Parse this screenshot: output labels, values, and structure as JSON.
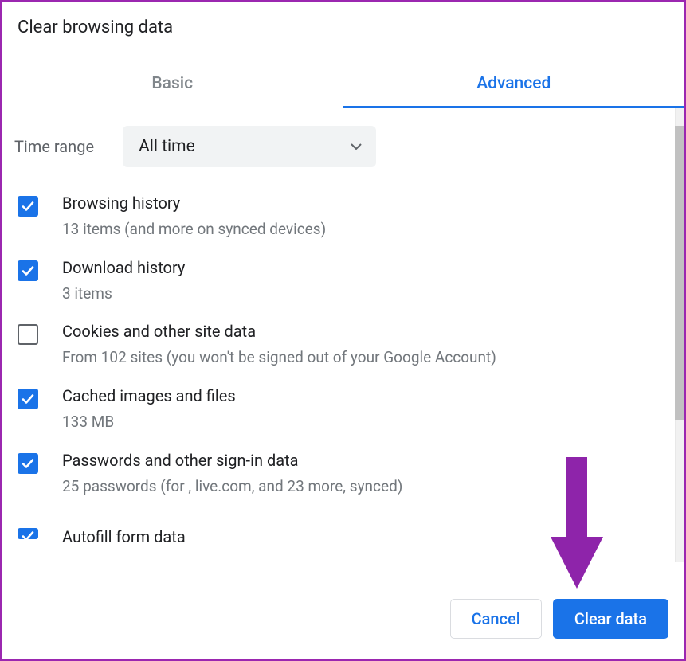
{
  "dialog": {
    "title": "Clear browsing data",
    "tabs": {
      "basic": "Basic",
      "advanced": "Advanced"
    },
    "time_range": {
      "label": "Time range",
      "value": "All time"
    },
    "items": [
      {
        "title": "Browsing history",
        "sub": "13 items (and more on synced devices)",
        "checked": true
      },
      {
        "title": "Download history",
        "sub": "3 items",
        "checked": true
      },
      {
        "title": "Cookies and other site data",
        "sub": "From 102 sites (you won't be signed out of your Google Account)",
        "checked": false
      },
      {
        "title": "Cached images and files",
        "sub": "133 MB",
        "checked": true
      },
      {
        "title": "Passwords and other sign-in data",
        "sub": "25 passwords (for , live.com, and 23 more, synced)",
        "checked": true
      },
      {
        "title": "Autofill form data",
        "sub": "",
        "checked": true
      }
    ],
    "buttons": {
      "cancel": "Cancel",
      "clear": "Clear data"
    }
  }
}
